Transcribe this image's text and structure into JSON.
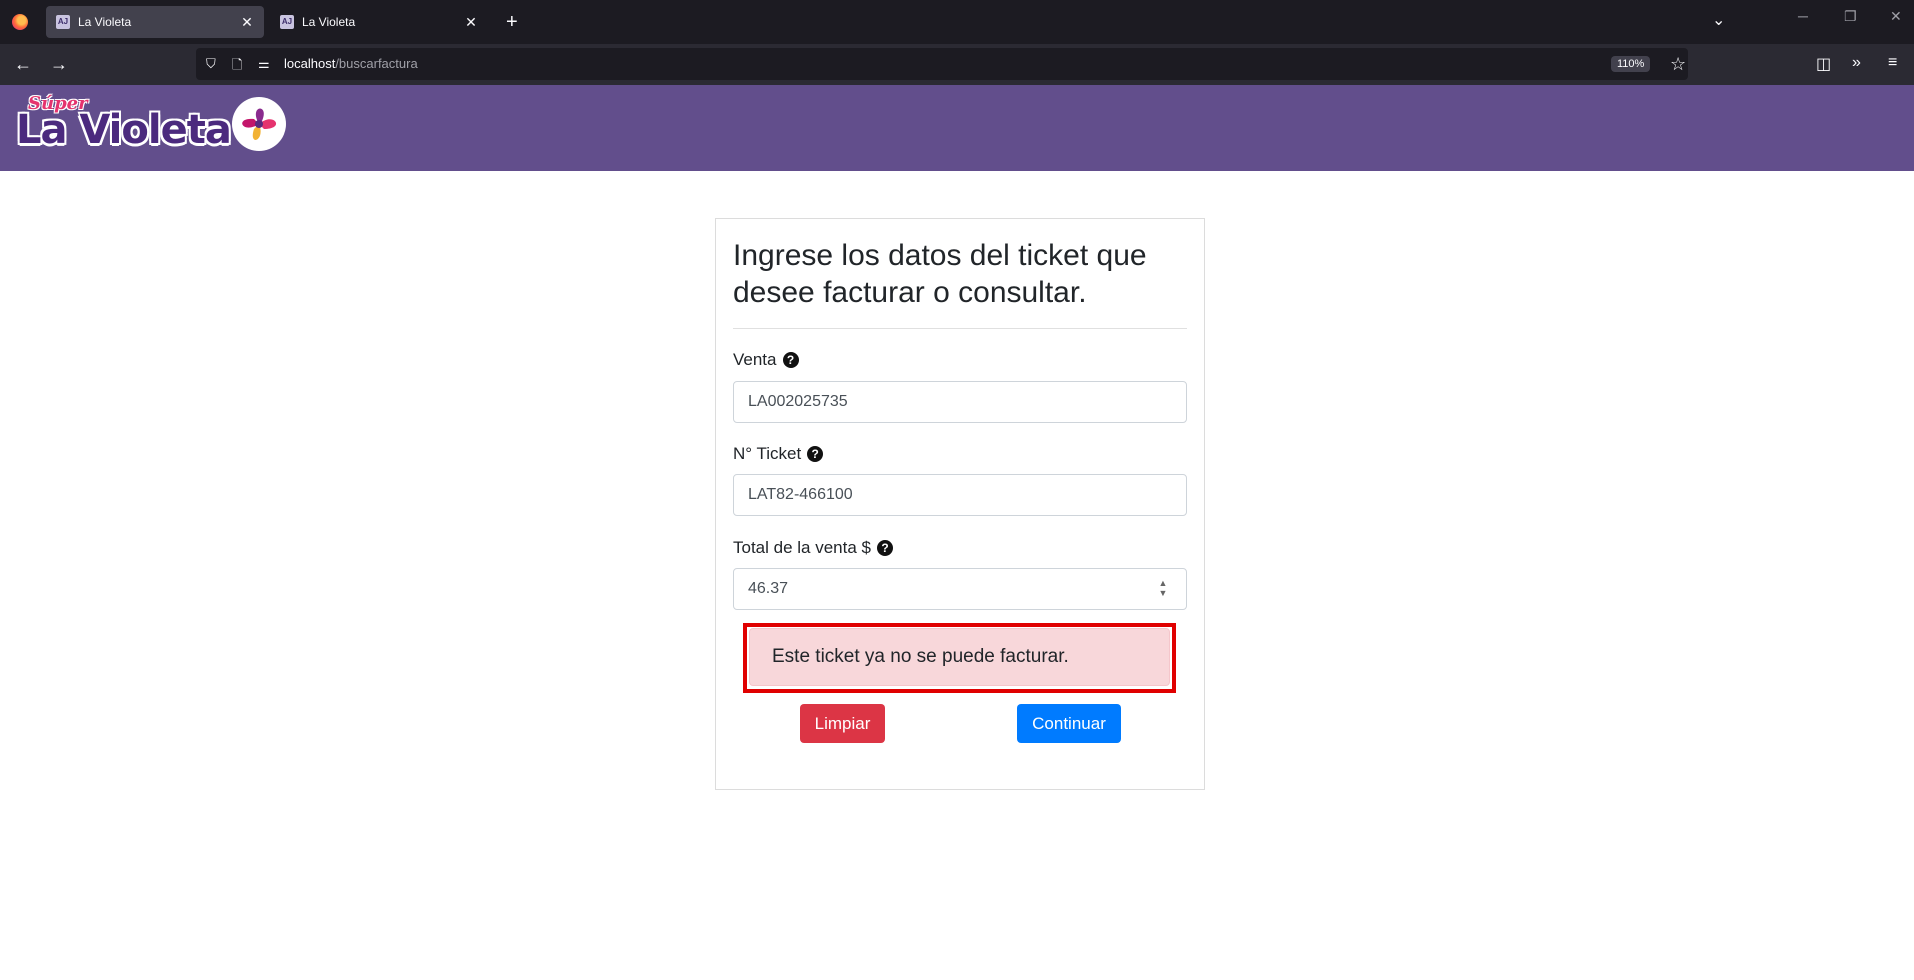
{
  "browser": {
    "tabs": [
      {
        "favicon": "AJ",
        "title": "La Violeta",
        "active": true
      },
      {
        "favicon": "AJ",
        "title": "La Violeta",
        "active": false
      }
    ],
    "url_host": "localhost",
    "url_path": "/buscarfactura",
    "zoom": "110%"
  },
  "header": {
    "logo_super": "Súper",
    "logo_main": "La Violeta",
    "brand_color": "#624e8c"
  },
  "form": {
    "heading": "Ingrese los datos del ticket que desee facturar o consultar.",
    "fields": [
      {
        "label": "Venta",
        "value": "LA002025735"
      },
      {
        "label": "N° Ticket",
        "value": "LAT82-466100"
      },
      {
        "label": "Total de la venta $",
        "value": "46.37"
      }
    ],
    "alert": "Este ticket ya no se puede facturar.",
    "clear_button": "Limpiar",
    "continue_button": "Continuar"
  }
}
